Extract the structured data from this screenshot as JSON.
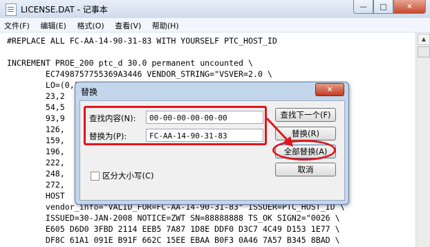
{
  "window": {
    "title": "LICENSE.DAT - 记事本",
    "min_label": "—",
    "max_label": "□",
    "close_label": "✕"
  },
  "menu": [
    "文件(F)",
    "编辑(E)",
    "格式(O)",
    "查看(V)",
    "帮助(H)"
  ],
  "editor_lines": [
    "#REPLACE ALL FC-AA-14-90-31-83 WITH YOURSELF PTC_HOST_ID",
    "",
    "INCREMENT PROE_200 ptc_d 30.0 permanent uncounted \\",
    "        EC7498757755369A3446 VENDOR_STRING=\"VSVER=2.0 \\",
    "        LO=(0,3,6,7,9,10,14,16,17,18,21,22,",
    "        23,2                                          52,53, \\",
    "        54,5                                          91,92, \\",
    "        93,9                                          22,123,125, \\",
    "        126,                                          6,157,158, \\",
    "        159,                                          3,194,195, \\",
    "        196,                                          9,210,213,217, \\",
    "        222,                                          9,240,241,246, \\",
    "        248,                                          3,264,265,266, \\",
    "        272,",
    "        HOST",
    "        vendor_info=\"VALID_FOR=FC-AA-14-90-31-83\" ISSUER=PTC_HOST_ID \\",
    "        ISSUED=30-JAN-2008 NOTICE=ZWT SN=88888888 TS_OK SIGN2=\"0026 \\",
    "        E605 D6D0 3FBD 2114 EEB5 7A87 1D8E DDF0 D3C7 4C49 D153 1E77 \\",
    "        DF8C 61A1 091E B91F 662C 15EE EBAA B0F3 0A46 7A57 B345 8BAD \\"
  ],
  "dialog": {
    "title": "替换",
    "close_label": "✕",
    "find_label": "查找内容(N):",
    "find_value": "00-00-00-00-00-00",
    "replace_label": "替换为(P):",
    "replace_value": "FC-AA-14-90-31-83",
    "find_next_button": "查找下一个(F)",
    "replace_button": "替换(R)",
    "replace_all_button": "全部替换(A)",
    "cancel_button": "取消",
    "match_case_label": "区分大小写(C)",
    "match_case_checked": false
  },
  "annotation_color": "#e3131a"
}
